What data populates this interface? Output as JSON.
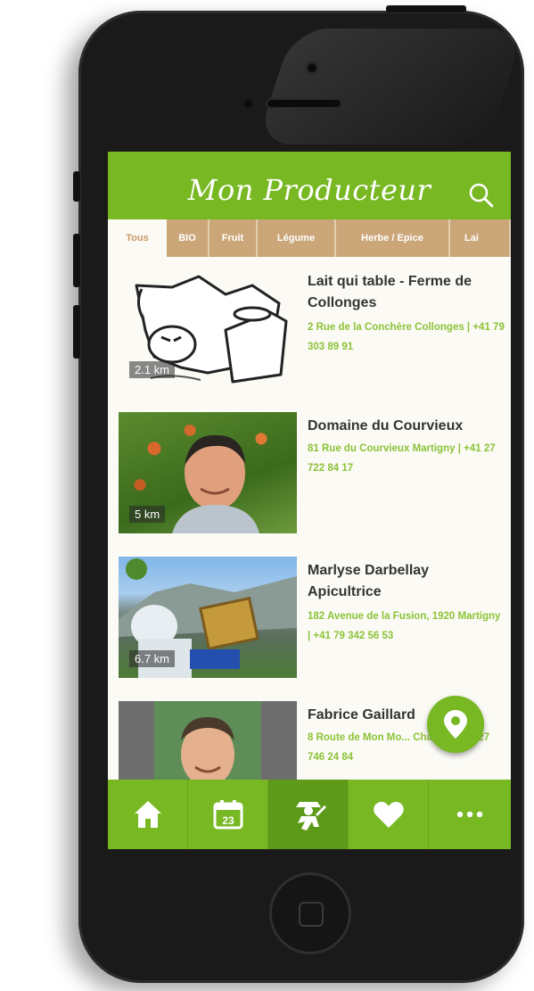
{
  "app": {
    "title": "Mon Producteur"
  },
  "tabs": [
    {
      "label": "Tous",
      "active": true
    },
    {
      "label": "BIO",
      "active": false
    },
    {
      "label": "Fruit",
      "active": false
    },
    {
      "label": "Légume",
      "active": false
    },
    {
      "label": "Herbe / Epice",
      "active": false
    },
    {
      "label": "Lai",
      "active": false
    }
  ],
  "producers": [
    {
      "name": "Lait qui table - Ferme de Collonges",
      "address": "2 Rue de la Conchère Collonges | +41 79 303 89 91",
      "distance": "2.1 km"
    },
    {
      "name": "Domaine du Courvieux",
      "address": "81 Rue du Courvieux Martigny | +41 27 722 84 17",
      "distance": "5 km"
    },
    {
      "name": "Marlyse Darbellay Apicultrice",
      "address": "182 Avenue de la Fusion, 1920 Martigny | +41 79 342 56 53",
      "distance": "6.7 km"
    },
    {
      "name": "Fabrice Gaillard",
      "address": "8 Route de Mon Mo... Charrat | +41 27 746 24 84",
      "distance": ""
    }
  ],
  "calendar_day": "23",
  "colors": {
    "primary": "#77b823",
    "tab_bar": "#cba679",
    "address": "#8cc338"
  },
  "icons": {
    "search": "search-icon",
    "home": "home-icon",
    "calendar": "calendar-icon",
    "producer": "producer-icon",
    "favorites": "heart-icon",
    "more": "more-icon",
    "map": "map-pin-icon"
  }
}
